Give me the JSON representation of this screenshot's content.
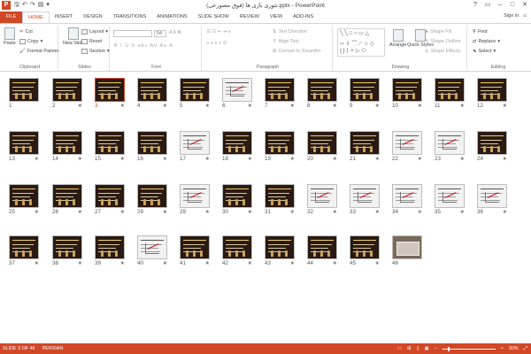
{
  "titlebar": {
    "app_letter": "P",
    "title": "تئوری بازی ها (فوق مصورعی).pptx - PowerPoint",
    "qat": [
      "save-icon",
      "undo-icon",
      "redo-icon",
      "present-icon"
    ],
    "controls": [
      "?",
      "▭",
      "–",
      "□",
      "✕"
    ]
  },
  "tabs": [
    "FILE",
    "HOME",
    "INSERT",
    "DESIGN",
    "TRANSITIONS",
    "ANIMATIONS",
    "SLIDE SHOW",
    "REVIEW",
    "VIEW",
    "ADD-INS"
  ],
  "active_tab": "HOME",
  "signin": "Sign in",
  "ribbon": {
    "clipboard": {
      "label": "Clipboard",
      "paste": "Paste",
      "cut": "Cut",
      "copy": "Copy",
      "format_painter": "Format Painter"
    },
    "slides": {
      "label": "Slides",
      "new_slide": "New Slide",
      "layout": "Layout",
      "reset": "Reset",
      "section": "Section"
    },
    "font": {
      "label": "Font",
      "font_name": "",
      "font_size": "54",
      "row2": "B I U S abc AV Aa A",
      "row1_extra": "A A ✥"
    },
    "paragraph": {
      "label": "Paragraph",
      "text_direction": "Text Direction",
      "align_text": "Align Text",
      "convert": "Convert to SmartArt"
    },
    "drawing": {
      "label": "Drawing",
      "arrange": "Arrange",
      "quick_styles": "Quick Styles",
      "shape_fill": "Shape Fill",
      "shape_outline": "Shape Outline",
      "shape_effects": "Shape Effects"
    },
    "editing": {
      "label": "Editing",
      "find": "Find",
      "replace": "Replace",
      "select": "Select"
    }
  },
  "slides": [
    {
      "n": "1",
      "star": "",
      "kind": "dark"
    },
    {
      "n": "2",
      "star": "★",
      "kind": "dark"
    },
    {
      "n": "3",
      "star": "★",
      "kind": "dark",
      "selected": true
    },
    {
      "n": "4",
      "star": "★",
      "kind": "dark"
    },
    {
      "n": "5",
      "star": "★",
      "kind": "dark"
    },
    {
      "n": "6",
      "star": "★",
      "kind": "light"
    },
    {
      "n": "7",
      "star": "★",
      "kind": "dark"
    },
    {
      "n": "8",
      "star": "★",
      "kind": "dark"
    },
    {
      "n": "9",
      "star": "★",
      "kind": "dark"
    },
    {
      "n": "10",
      "star": "★",
      "kind": "dark"
    },
    {
      "n": "11",
      "star": "★",
      "kind": "dark"
    },
    {
      "n": "12",
      "star": "★",
      "kind": "dark"
    },
    {
      "n": "13",
      "star": "★",
      "kind": "dark"
    },
    {
      "n": "14",
      "star": "★",
      "kind": "dark"
    },
    {
      "n": "15",
      "star": "★",
      "kind": "dark"
    },
    {
      "n": "16",
      "star": "★",
      "kind": "dark"
    },
    {
      "n": "17",
      "star": "★",
      "kind": "light"
    },
    {
      "n": "18",
      "star": "★",
      "kind": "dark"
    },
    {
      "n": "19",
      "star": "★",
      "kind": "dark"
    },
    {
      "n": "20",
      "star": "★",
      "kind": "dark"
    },
    {
      "n": "21",
      "star": "★",
      "kind": "dark"
    },
    {
      "n": "22",
      "star": "★",
      "kind": "light"
    },
    {
      "n": "23",
      "star": "★",
      "kind": "light"
    },
    {
      "n": "24",
      "star": "★",
      "kind": "dark"
    },
    {
      "n": "25",
      "star": "★",
      "kind": "dark"
    },
    {
      "n": "26",
      "star": "★",
      "kind": "dark"
    },
    {
      "n": "27",
      "star": "★",
      "kind": "dark"
    },
    {
      "n": "28",
      "star": "★",
      "kind": "dark"
    },
    {
      "n": "29",
      "star": "★",
      "kind": "light"
    },
    {
      "n": "30",
      "star": "★",
      "kind": "dark"
    },
    {
      "n": "31",
      "star": "★",
      "kind": "dark"
    },
    {
      "n": "32",
      "star": "★",
      "kind": "light"
    },
    {
      "n": "33",
      "star": "★",
      "kind": "light"
    },
    {
      "n": "34",
      "star": "★",
      "kind": "light"
    },
    {
      "n": "35",
      "star": "★",
      "kind": "light"
    },
    {
      "n": "36",
      "star": "★",
      "kind": "light"
    },
    {
      "n": "37",
      "star": "★",
      "kind": "dark"
    },
    {
      "n": "38",
      "star": "★",
      "kind": "dark"
    },
    {
      "n": "39",
      "star": "★",
      "kind": "dark"
    },
    {
      "n": "40",
      "star": "★",
      "kind": "light"
    },
    {
      "n": "41",
      "star": "★",
      "kind": "dark"
    },
    {
      "n": "42",
      "star": "★",
      "kind": "dark"
    },
    {
      "n": "43",
      "star": "★",
      "kind": "dark"
    },
    {
      "n": "44",
      "star": "★",
      "kind": "dark"
    },
    {
      "n": "45",
      "star": "★",
      "kind": "dark"
    },
    {
      "n": "46",
      "star": "",
      "kind": "photo"
    }
  ],
  "status": {
    "slide_info": "SLIDE 3 OF 46",
    "language": "PERSIAN",
    "zoom": "30%",
    "zoom_fraction": 0.3,
    "accent": "#d24726"
  }
}
